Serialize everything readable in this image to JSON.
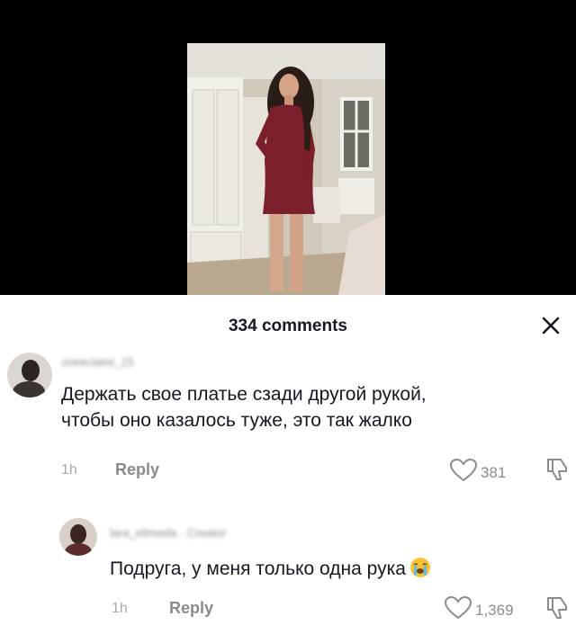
{
  "panel": {
    "title": "334 comments"
  },
  "comments": [
    {
      "username": "zoeeclaire_15",
      "text_line1": "Держать свое платье сзади другой рукой,",
      "text_line2": "чтобы оно казалось туже, это так жалко",
      "time": "1h",
      "reply_label": "Reply",
      "like_count": "381"
    },
    {
      "username": "lara_elimeda · Creator",
      "text": "Подруга, у меня только одна рука",
      "emoji_icon": "loudly-crying-face-icon",
      "time": "1h",
      "reply_label": "Reply",
      "like_count": "1,369"
    }
  ],
  "icons": {
    "close": "close-icon",
    "like": "heart-icon",
    "dislike": "dislike-icon"
  },
  "colors": {
    "video_bg": "#000000",
    "text_primary": "#161823",
    "text_secondary": "#8a8b91",
    "dress": "#7a1f2b"
  }
}
